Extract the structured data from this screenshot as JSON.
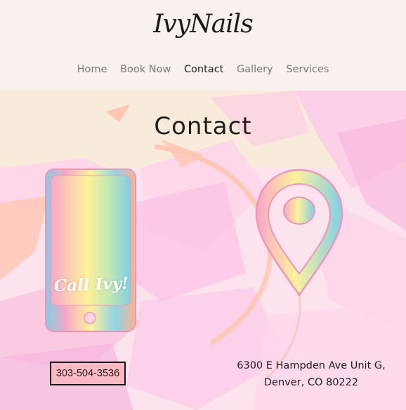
{
  "header": {
    "logo_text": "IvyNails",
    "nav": [
      {
        "label": "Home",
        "active": false
      },
      {
        "label": "Book Now",
        "active": false
      },
      {
        "label": "Contact",
        "active": true
      },
      {
        "label": "Gallery",
        "active": false
      },
      {
        "label": "Services",
        "active": false
      }
    ]
  },
  "page": {
    "title": "Contact",
    "phone_graphic_text": "Call Ivy!",
    "phone_button_label": "303-504-3536",
    "address_line1": "6300 E Hampden Ave Unit G,",
    "address_line2": "Denver, CO 80222"
  },
  "colors": {
    "header_bg": "#f8f1ed",
    "hero_base": "#fde3ee",
    "cream": "#f9ebdc",
    "pink_light": "#ffd7eb",
    "pink_mid": "#fcc3e5",
    "peach": "#ffc6b0",
    "accent_outline": "#f195b8",
    "button_bg": "#fbb9c3",
    "text_dark": "#1e1e1e",
    "nav_text": "#7a7a7a"
  },
  "icons": [
    "smartphone-icon",
    "location-pin-icon"
  ]
}
